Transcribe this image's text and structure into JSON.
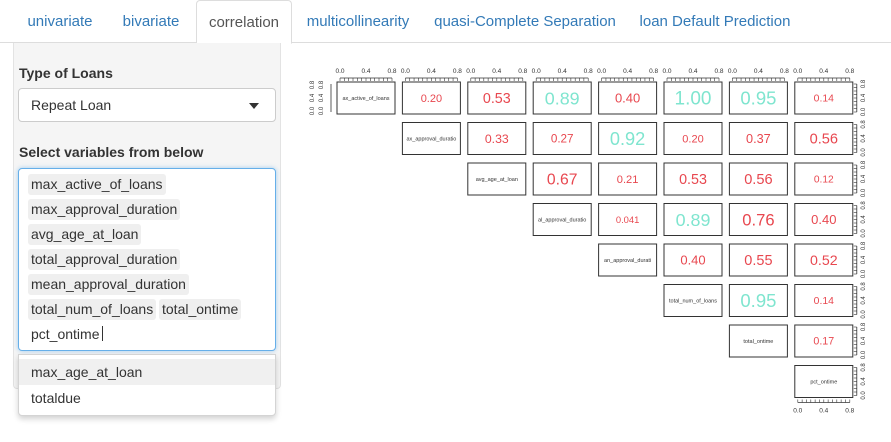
{
  "tabs": [
    {
      "label": "univariate",
      "active": false
    },
    {
      "label": "bivariate",
      "active": false
    },
    {
      "label": "correlation",
      "active": true
    },
    {
      "label": "multicollinearity",
      "active": false
    },
    {
      "label": "quasi-Complete Separation",
      "active": false
    },
    {
      "label": "loan Default Prediction",
      "active": false
    }
  ],
  "sidebar": {
    "type_label": "Type of Loans",
    "type_value": "Repeat Loan",
    "vars_label": "Select variables from below",
    "selected": [
      "max_active_of_loans",
      "max_approval_duration",
      "avg_age_at_loan",
      "total_approval_duration",
      "mean_approval_duration",
      "total_num_of_loans",
      "total_ontime",
      "pct_ontime"
    ],
    "dropdown_options": [
      "max_age_at_loan",
      "totaldue"
    ]
  },
  "colors": {
    "link": "#337ab7",
    "focus_border": "#66afe9",
    "corr_high": "#7fe5cf",
    "corr_low": "#e8474f"
  },
  "chart_data": {
    "type": "heatmap",
    "variables": [
      "max_active_of_loans",
      "max_approval_duration",
      "avg_age_at_loan",
      "total_approval_duration",
      "mean_approval_duration",
      "total_num_of_loans",
      "total_ontime",
      "pct_ontime"
    ],
    "diagonal_labels": [
      "ax_active_of_loans",
      "ax_approval_duratio",
      "avg_age_at_loan",
      "al_approval_duratio",
      "an_approval_durati",
      "total_num_of_loans",
      "total_ontime",
      "pct_ontime"
    ],
    "correlations": [
      {
        "row": 0,
        "col": 1,
        "label": "0.20"
      },
      {
        "row": 0,
        "col": 2,
        "label": "0.53"
      },
      {
        "row": 0,
        "col": 3,
        "label": "0.89"
      },
      {
        "row": 0,
        "col": 4,
        "label": "0.40"
      },
      {
        "row": 0,
        "col": 5,
        "label": "1.00"
      },
      {
        "row": 0,
        "col": 6,
        "label": "0.95"
      },
      {
        "row": 0,
        "col": 7,
        "label": "0.14"
      },
      {
        "row": 1,
        "col": 2,
        "label": "0.33"
      },
      {
        "row": 1,
        "col": 3,
        "label": "0.27"
      },
      {
        "row": 1,
        "col": 4,
        "label": "0.92"
      },
      {
        "row": 1,
        "col": 5,
        "label": "0.20"
      },
      {
        "row": 1,
        "col": 6,
        "label": "0.37"
      },
      {
        "row": 1,
        "col": 7,
        "label": "0.56"
      },
      {
        "row": 2,
        "col": 3,
        "label": "0.67"
      },
      {
        "row": 2,
        "col": 4,
        "label": "0.21"
      },
      {
        "row": 2,
        "col": 5,
        "label": "0.53"
      },
      {
        "row": 2,
        "col": 6,
        "label": "0.56"
      },
      {
        "row": 2,
        "col": 7,
        "label": "0.12"
      },
      {
        "row": 3,
        "col": 4,
        "label": "0.041"
      },
      {
        "row": 3,
        "col": 5,
        "label": "0.89"
      },
      {
        "row": 3,
        "col": 6,
        "label": "0.76"
      },
      {
        "row": 3,
        "col": 7,
        "label": "0.40"
      },
      {
        "row": 4,
        "col": 5,
        "label": "0.40"
      },
      {
        "row": 4,
        "col": 6,
        "label": "0.55"
      },
      {
        "row": 4,
        "col": 7,
        "label": "0.52"
      },
      {
        "row": 5,
        "col": 6,
        "label": "0.95"
      },
      {
        "row": 5,
        "col": 7,
        "label": "0.14"
      },
      {
        "row": 6,
        "col": 7,
        "label": "0.17"
      }
    ],
    "axis_ticks": [
      "0.0",
      "0.4",
      "0.8"
    ]
  }
}
